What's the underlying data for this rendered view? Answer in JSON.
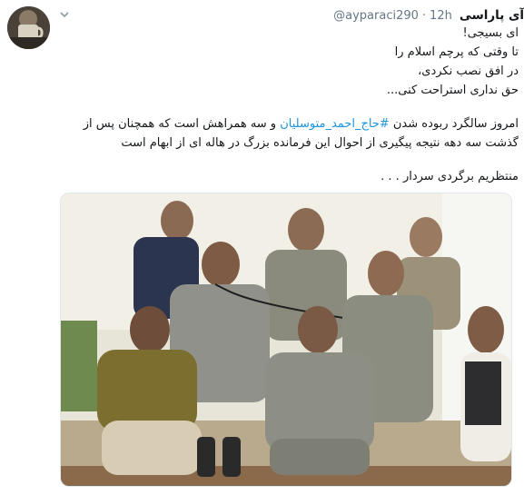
{
  "tweet": {
    "display_name": "آی پاراسی",
    "handle": "@ayparaci290",
    "separator": "·",
    "time": "12h",
    "lines": [
      "ای بسیجی!",
      "تا وقتی که پرچم اسلام را",
      "در افق نصب نکردی،",
      "حق نداری استراحت کنی..."
    ],
    "para2_prefix": "امروز سالگرد ربوده شدن ",
    "para2_hashtag": "#حاج_احمد_متوسلیان",
    "para2_suffix": " و سه همراهش است که همچنان پس از",
    "para2_line2": "گذشت سه دهه نتیجه پیگیری از احوال این فرمانده بزرگ در هاله ای از ابهام است",
    "closing": "منتظریم برگردی سردار . . ."
  },
  "icons": {
    "caret": "chevron-down-icon",
    "avatar": "avatar-photo",
    "photo": "group-photo"
  },
  "colors": {
    "hashtag": "#1b95e0",
    "meta": "#657786",
    "text": "#14171a"
  }
}
